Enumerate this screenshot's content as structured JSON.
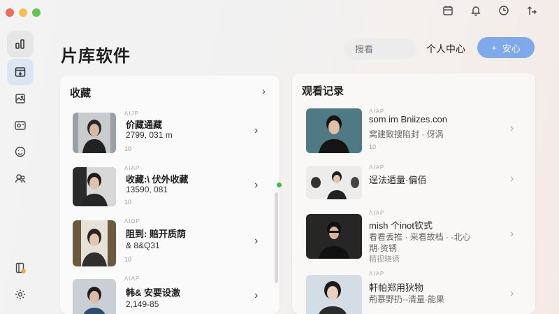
{
  "window": {
    "controls": [
      "close",
      "minimize",
      "zoom"
    ]
  },
  "sidebar": {
    "items": [
      {
        "icon": "chart-bars-icon"
      },
      {
        "icon": "download-box-icon"
      },
      {
        "icon": "image-icon"
      },
      {
        "icon": "camera-icon"
      },
      {
        "icon": "smile-face-icon"
      },
      {
        "icon": "users-icon"
      }
    ],
    "bottom": [
      {
        "icon": "notebook-icon"
      },
      {
        "icon": "gear-icon"
      }
    ]
  },
  "topbar": {
    "icons": [
      "calendar-icon",
      "bell-icon",
      "clock-icon",
      "share-icon"
    ]
  },
  "header": {
    "title": "片库软件",
    "search_placeholder": "搜看",
    "profile_label": "个人中心",
    "add_label": "安心",
    "add_icon": "+"
  },
  "favorites": {
    "title": "收藏",
    "items": [
      {
        "tag": "ΛIJP",
        "title": "价藏通藏",
        "subtitle": "2799, 031 m",
        "meta": "10"
      },
      {
        "tag": "ΛIAP",
        "title": "收藏:\\ 伏外收藏",
        "subtitle": "13590, 081",
        "meta": "10"
      },
      {
        "tag": "ΛIΩP",
        "title": "阻到: 赔开质荫",
        "subtitle": "& 8&Q31",
        "meta": "10"
      },
      {
        "tag": "ΛIAP",
        "title": "韩& 安要设激",
        "subtitle": "2,149-85",
        "meta": ""
      }
    ]
  },
  "history": {
    "title": "观看记录",
    "items": [
      {
        "tag": "ΛIAP",
        "title": "som im Bniizes.con",
        "subtitle": "窝建致搜陷封 · 伢涡",
        "meta": "10"
      },
      {
        "tag": "ΛIAP",
        "title": "逞法遁量·偏佰",
        "subtitle": "",
        "meta": ""
      },
      {
        "tag": "ΛIAP",
        "title": "mish 个inot钦式",
        "subtitle": "看看丢推 · 来看故档 · -北心",
        "meta": "期·资锈",
        "meta2": "精视晓诱"
      },
      {
        "tag": "ΛIAP",
        "title": "軒帕郑用狄物",
        "subtitle": "荊慕野扔·-清量·能果",
        "meta": ""
      }
    ]
  },
  "colors": {
    "accent": "#7ea9ea",
    "status": "#3dbb4e",
    "selected": "#dbe6f5"
  }
}
